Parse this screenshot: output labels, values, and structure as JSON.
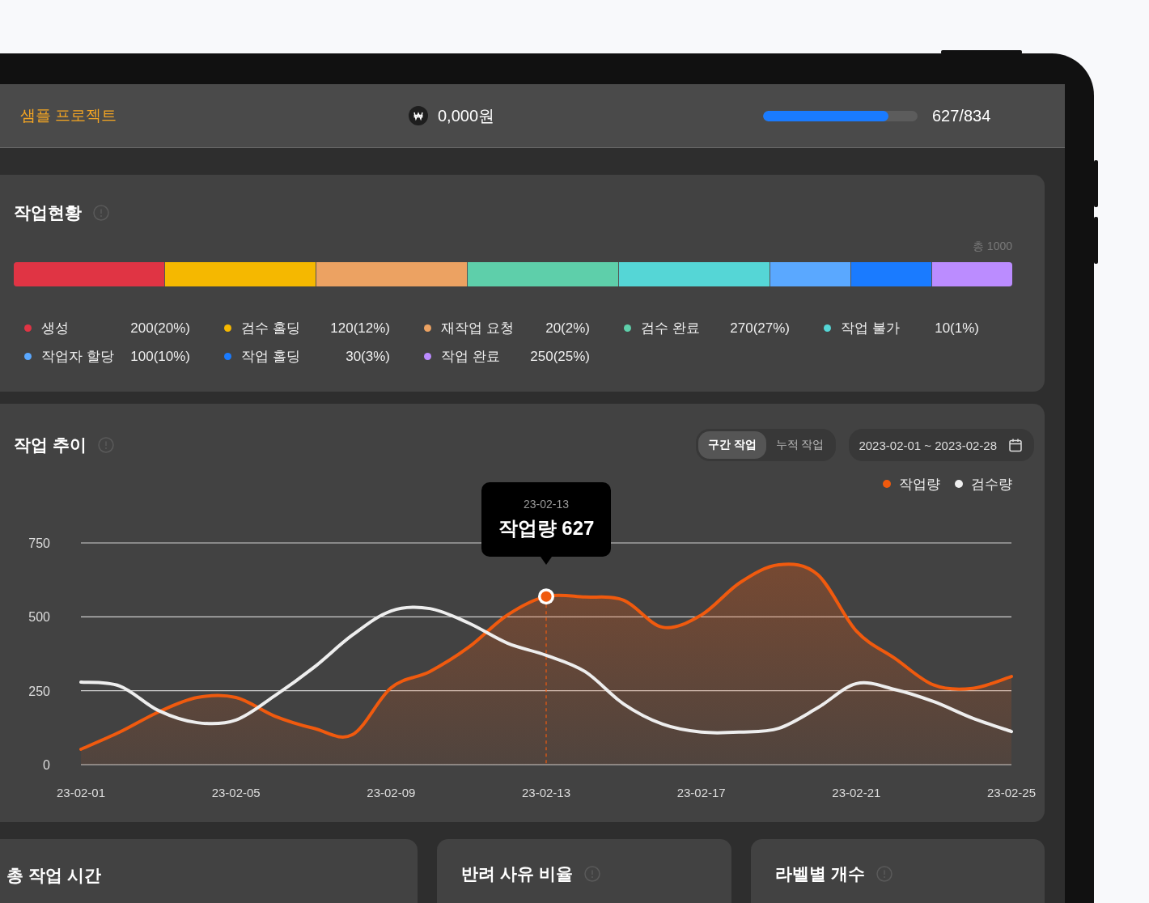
{
  "header": {
    "project_name": "샘플 프로젝트",
    "amount": "0,000원",
    "progress": {
      "level": 0.81,
      "reading": "627/834"
    }
  },
  "status_card": {
    "title": "작업현황",
    "total": "총 1000",
    "statuses": [
      {
        "name": "생성",
        "value": "200(20%)",
        "color": "#e03444",
        "kind": "wide"
      },
      {
        "name": "검수 홀딩",
        "value": "120(12%)",
        "color": "#f5b800",
        "kind": "wide"
      },
      {
        "name": "재작업 요청",
        "value": "20(2%)",
        "color": "#eca262",
        "kind": "wide"
      },
      {
        "name": "검수 완료",
        "value": "270(27%)",
        "color": "#5ecfaa",
        "kind": "wide"
      },
      {
        "name": "작업 불가",
        "value": "10(1%)",
        "color": "#55d6d6",
        "kind": "wide"
      },
      {
        "name": "작업자 할당",
        "value": "100(10%)",
        "color": "#5aa8ff",
        "kind": "narrow"
      },
      {
        "name": "작업 홀딩",
        "value": "30(3%)",
        "color": "#1a7bff",
        "kind": "narrow"
      },
      {
        "name": "작업 완료",
        "value": "250(25%)",
        "color": "#bb8cff",
        "kind": "narrow"
      }
    ]
  },
  "trend_card": {
    "title": "작업 추이",
    "modes": [
      {
        "label": "구간 작업",
        "selected": true
      },
      {
        "label": "누적 작업",
        "selected": false
      }
    ],
    "date_range": "2023-02-01 ~ 2023-02-28",
    "tooltip_date": "23-02-13",
    "chart_data": {
      "type": "line",
      "categories": [
        "23-02-01",
        null,
        null,
        null,
        "23-02-05",
        null,
        null,
        null,
        "23-02-09",
        null,
        null,
        null,
        "23-02-13",
        null,
        null,
        null,
        "23-02-17",
        null,
        null,
        null,
        "23-02-21",
        null,
        null,
        null,
        "23-02-25"
      ],
      "series": [
        {
          "name": "작업량",
          "color": "#f05a0e",
          "type": "area",
          "values": [
            52,
            110,
            178,
            227,
            227,
            164,
            123,
            101,
            260,
            315,
            397,
            506,
            569,
            567,
            556,
            465,
            506,
            616,
            676,
            643,
            452,
            359,
            269,
            258,
            298
          ]
        },
        {
          "name": "검수량",
          "color": "#eeeeee",
          "type": "line",
          "values": [
            279,
            266,
            183,
            142,
            151,
            233,
            328,
            438,
            520,
            528,
            479,
            411,
            370,
            315,
            205,
            137,
            110,
            110,
            123,
            192,
            274,
            254,
            213,
            157,
            112
          ]
        }
      ],
      "ylim": [
        0,
        750
      ],
      "yticks": [
        0,
        250,
        500,
        750
      ],
      "annotations": [
        {
          "x": "23-02-13",
          "y": 569,
          "text": "작업량 627"
        }
      ]
    }
  },
  "bottom_cards": [
    {
      "title": "총 작업 시간",
      "info": false
    },
    {
      "title": "반려 사유 비율",
      "info": true
    },
    {
      "title": "라벨별 개수",
      "info": true
    }
  ]
}
